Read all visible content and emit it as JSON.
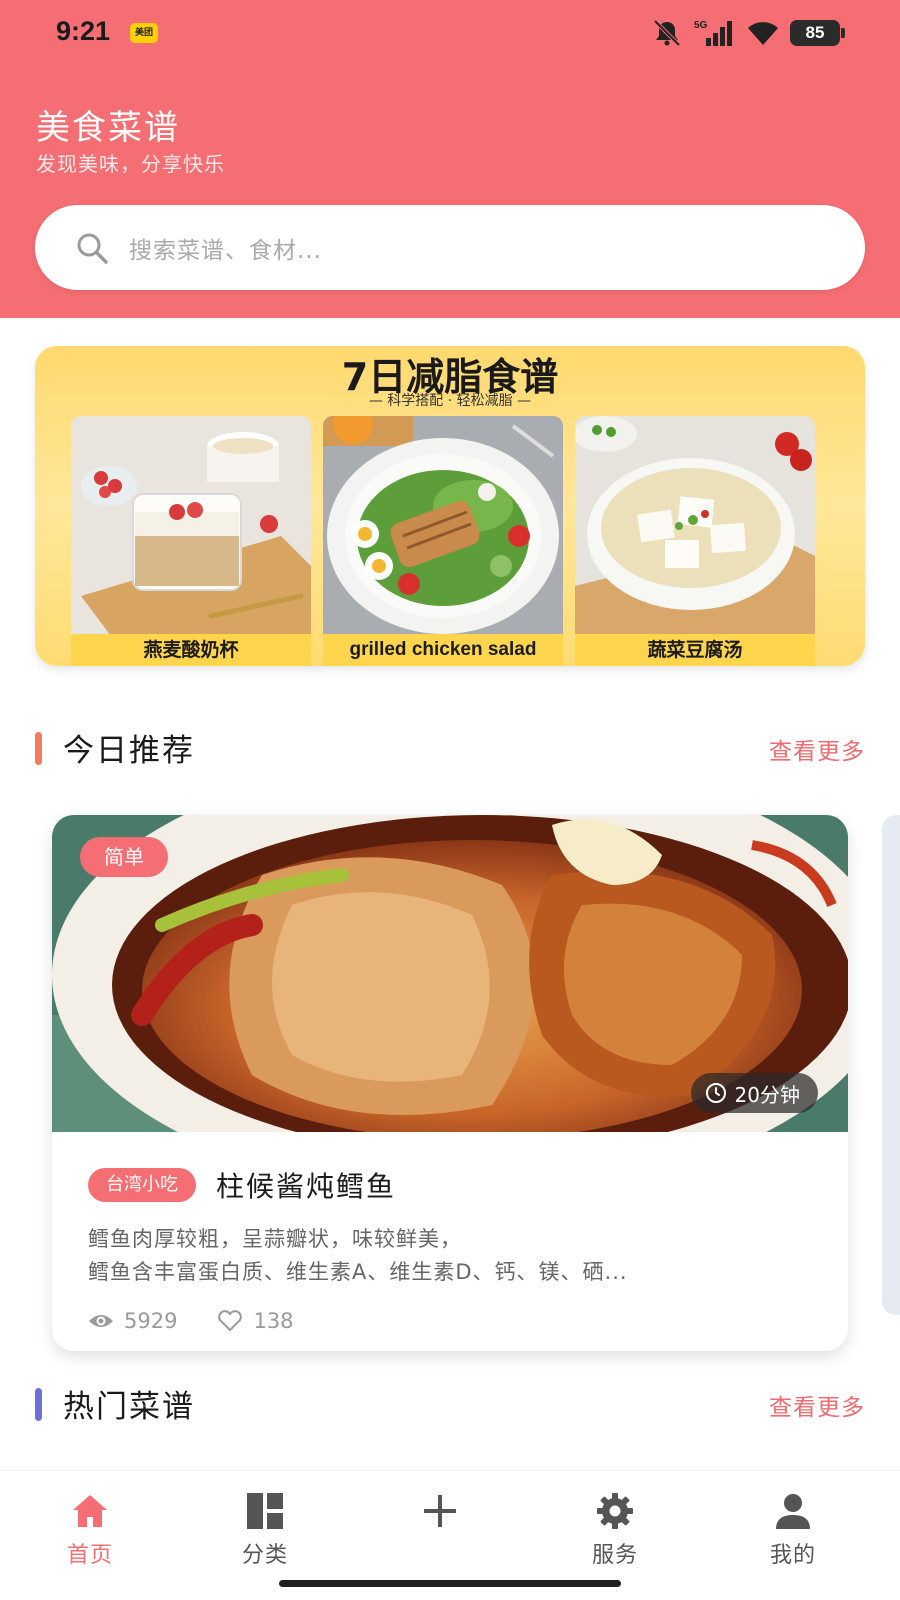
{
  "status_bar": {
    "time": "9:21",
    "app_badge": "美团",
    "network": "5G",
    "battery": "85"
  },
  "header": {
    "title": "美食菜谱",
    "subtitle": "发现美味，分享快乐"
  },
  "search": {
    "placeholder": "搜索菜谱、食材..."
  },
  "banner": {
    "title": "7日减脂食谱",
    "subtitle": "— 科学搭配 · 轻松减脂 —",
    "items": [
      {
        "caption": "燕麦酸奶杯"
      },
      {
        "caption": "grilled chicken salad"
      },
      {
        "caption": "蔬菜豆腐汤"
      }
    ]
  },
  "sections": {
    "recommend": {
      "title": "今日推荐",
      "more": "查看更多",
      "accent": "#f47c5e"
    },
    "popular": {
      "title": "热门菜谱",
      "more": "查看更多",
      "accent": "#6f6fd8"
    }
  },
  "recipe": {
    "difficulty": "简单",
    "time": "20分钟",
    "region_tag": "台湾小吃",
    "title": "柱候酱炖鳕鱼",
    "desc_line1": "鳕鱼肉厚较粗，呈蒜瓣状，味较鲜美，",
    "desc_line2": "鳕鱼含丰富蛋白质、维生素A、维生素D、钙、镁、硒...",
    "views": "5929",
    "likes": "138"
  },
  "nav": {
    "items": [
      {
        "label": "首页",
        "icon": "home-icon",
        "active": true
      },
      {
        "label": "分类",
        "icon": "category-icon",
        "active": false
      },
      {
        "label": "",
        "icon": "plus-icon",
        "active": false
      },
      {
        "label": "服务",
        "icon": "gear-icon",
        "active": false
      },
      {
        "label": "我的",
        "icon": "user-icon",
        "active": false
      }
    ]
  },
  "colors": {
    "brand": "#f46e73",
    "banner_yellow": "#ffd96e"
  }
}
